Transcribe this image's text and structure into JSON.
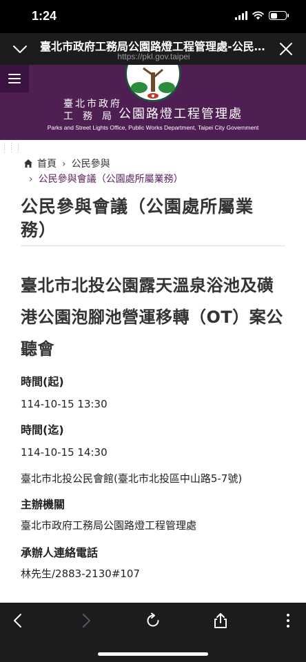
{
  "status_bar": {
    "time": "1:24",
    "battery_level": 0.45
  },
  "browser": {
    "title": "臺北市政府工務局公園路燈工程管理處-公民參與會議（公園處所屬業務）",
    "url": "https://pkl.gov.taipei"
  },
  "site_header": {
    "name_small_line1": "臺北市政府",
    "name_small_line2": "工務局",
    "name_big": "公園路燈工程管理處",
    "name_en": "Parks and Street Lights Office, Public Works Department, Taipei City Government"
  },
  "breadcrumb": {
    "home": "首頁",
    "level1": "公民參與",
    "current": "公民參與會議（公園處所屬業務）"
  },
  "page_title": "公民參與會議（公園處所屬業務）",
  "event": {
    "title": "臺北市北投公園露天溫泉浴池及磺港公園泡腳池營運移轉（OT）案公聽會",
    "start_label": "時間(起)",
    "start_value": "114-10-15 13:30",
    "end_label": "時間(迄)",
    "end_value": "114-10-15 14:30",
    "location": "臺北市北投公民會館(臺北市北投區中山路5-7號)",
    "organizer_label": "主辦機關",
    "organizer_value": "臺北市政府工務局公園路燈工程管理處",
    "contact_label": "承辦人連絡電話",
    "contact_value": "林先生/2883-2130#107"
  },
  "colors": {
    "brand_purple": "#4f1f54",
    "link_purple": "#5b2660"
  }
}
